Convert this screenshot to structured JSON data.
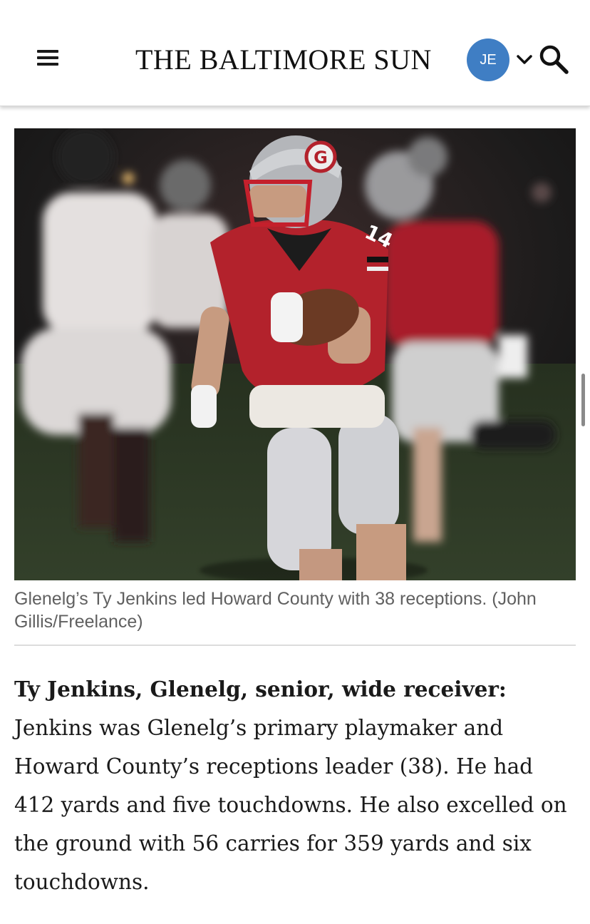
{
  "header": {
    "logo_text": "THE BALTIMORE SUN",
    "avatar_initials": "JE"
  },
  "photo": {
    "jersey_number": "14",
    "helmet_letter": "G"
  },
  "caption": {
    "text": "Glenelg’s Ty Jenkins led Howard County with 38 receptions. (John Gillis/Freelance)"
  },
  "article": {
    "lead_bold": "Ty Jenkins, Glenelg, senior, wide receiver:",
    "body": " Jenkins was Glenelg’s primary playmaker and Howard County’s receptions leader (38). He had 412 yards and five touchdowns. He also excelled on the ground with 56 carries for 359 yards and six touchdowns."
  },
  "colors": {
    "avatar": "#3f7ec4",
    "jersey_red": "#b3222c",
    "field_green": "#2f3a26"
  }
}
